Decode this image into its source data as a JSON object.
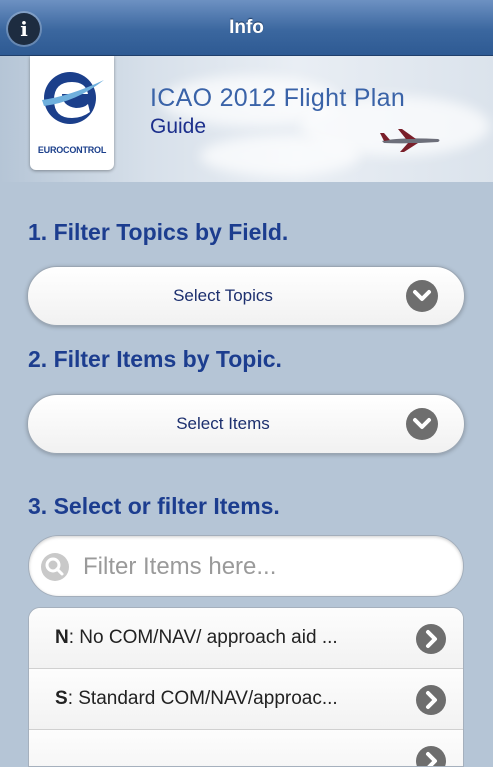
{
  "header": {
    "title": "Info",
    "info_icon": "info-icon"
  },
  "banner": {
    "logo_text": "EUROCONTROL",
    "title": "ICAO 2012 Flight Plan",
    "subtitle": "Guide"
  },
  "sections": [
    {
      "heading": "1. Filter Topics by Field."
    },
    {
      "heading": "2. Filter Items by Topic."
    },
    {
      "heading": "3. Select or filter Items."
    }
  ],
  "selects": {
    "topics": {
      "label": "Select Topics",
      "icon": "chevron-down-icon"
    },
    "items": {
      "label": "Select Items",
      "icon": "chevron-down-icon"
    }
  },
  "search": {
    "placeholder": "Filter Items here...",
    "value": ""
  },
  "list": {
    "items": [
      {
        "code": "N",
        "text": ": No COM/NAV/ approach aid ...",
        "icon": "chevron-right-icon"
      },
      {
        "code": "S",
        "text": ": Standard COM/NAV/approac...",
        "icon": "chevron-right-icon"
      },
      {
        "code": "",
        "text": "",
        "icon": "chevron-right-icon"
      }
    ]
  },
  "colors": {
    "header": "#3b679f",
    "background": "#b5c5d6",
    "heading": "#1c3d8f",
    "chevron_button": "#6e6e6e"
  }
}
